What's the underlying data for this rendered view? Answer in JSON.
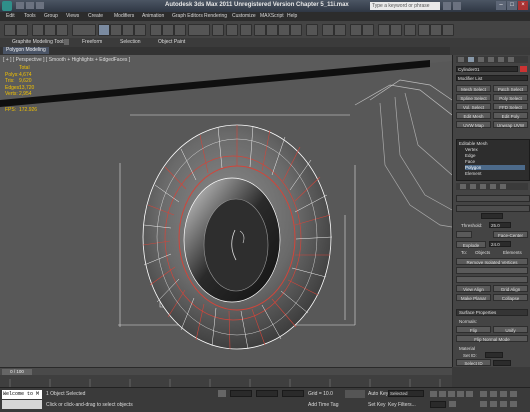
{
  "title_bar": {
    "title": "Autodesk 3ds Max  2011    Unregistered Version    Chapter 5_11i.max",
    "search_placeholder": "Type a keyword or phrase"
  },
  "menu": [
    "Edit",
    "Tools",
    "Group",
    "Views",
    "Create",
    "Modifiers",
    "Animation",
    "Graph Editors",
    "Rendering",
    "Customize",
    "MAXScript",
    "Help"
  ],
  "ribbon": {
    "tabs": [
      "Graphite Modeling Tools",
      "Freeform",
      "Selection",
      "Object Paint"
    ],
    "subtab": "Polygon Modeling"
  },
  "viewport": {
    "label": "[ + ] [ Perspective ] [ Smooth + Highlights + EdgedFaces ]",
    "stats": {
      "header": "Total",
      "rows": [
        {
          "k": "Polys:",
          "v": "4,674"
        },
        {
          "k": "Tris:",
          "v": "9,620"
        },
        {
          "k": "Edges:",
          "v": "13,720"
        },
        {
          "k": "Verts:",
          "v": "2,954"
        }
      ],
      "fps_label": "FPS:",
      "fps_value": "172.926"
    }
  },
  "panel": {
    "object_name": "Cylinder01",
    "modifier_list": "Modifier List",
    "buttons": [
      [
        "Mesh Select",
        "Patch Select"
      ],
      [
        "Spline Select",
        "Poly Select"
      ],
      [
        "Vol. Select",
        "FFD Select"
      ],
      [
        "Edit Mesh",
        "Edit Poly"
      ],
      [
        "UVW Map",
        "Unwrap UVW"
      ]
    ],
    "stack": [
      "Editable Mesh",
      "Vertex",
      "Edge",
      "Face",
      "Polygon",
      "Element"
    ],
    "stack_selected": "Polygon",
    "threshold_label": "Threshold:",
    "threshold_value": "25.0",
    "face_center": "Face-Center",
    "explode_label": "Explode",
    "explode_value": "24.0",
    "to_label": "To:",
    "objects_label": "Objects",
    "elements_label": "Elements",
    "remove_isolated": "Remove Isolated Vertices",
    "view_align": "View Align",
    "grid_align": "Grid Align",
    "make_planar": "Make Planar",
    "collapse": "Collapse",
    "surface_properties": "Surface Properties",
    "normals": "Normals:",
    "flip": "Flip",
    "unify": "Unify",
    "flip_normal_mode": "Flip Normal Mode",
    "material": "Material",
    "set_id": "Set ID:",
    "select_id": "Select ID"
  },
  "timeline": {
    "frame": "0 / 100"
  },
  "status": {
    "maxscript": "Welcome to M",
    "selected": "1 Object Selected",
    "prompt": "Click or click-and-drag to select objects",
    "grid": "Grid = 10.0",
    "add_time_tag": "Add Time Tag",
    "auto_key": "Auto Key",
    "selected_dd": "Selected",
    "set_key": "Set Key",
    "key_filters": "Key Filters..."
  },
  "colors": {
    "stat_text": "#f2c200",
    "viewport_bg": "#585858",
    "selection_red": "#d2453a"
  }
}
